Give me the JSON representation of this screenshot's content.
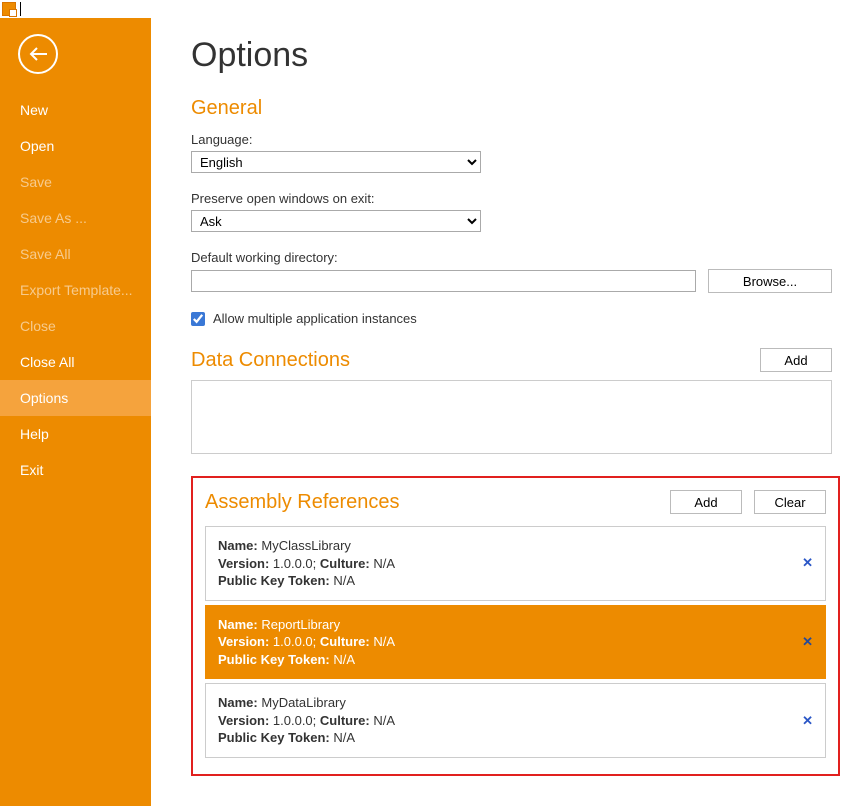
{
  "sidebar": {
    "items": [
      {
        "label": "New",
        "enabled": true,
        "selected": false
      },
      {
        "label": "Open",
        "enabled": true,
        "selected": false
      },
      {
        "label": "Save",
        "enabled": false,
        "selected": false
      },
      {
        "label": "Save As ...",
        "enabled": false,
        "selected": false
      },
      {
        "label": "Save All",
        "enabled": false,
        "selected": false
      },
      {
        "label": "Export Template...",
        "enabled": false,
        "selected": false
      },
      {
        "label": "Close",
        "enabled": false,
        "selected": false
      },
      {
        "label": "Close All",
        "enabled": true,
        "selected": false
      },
      {
        "label": "Options",
        "enabled": true,
        "selected": true
      },
      {
        "label": "Help",
        "enabled": true,
        "selected": false
      },
      {
        "label": "Exit",
        "enabled": true,
        "selected": false
      }
    ]
  },
  "page": {
    "title": "Options"
  },
  "general": {
    "heading": "General",
    "language_label": "Language:",
    "language_value": "English",
    "preserve_label": "Preserve open windows on exit:",
    "preserve_value": "Ask",
    "directory_label": "Default working directory:",
    "directory_value": "",
    "browse": "Browse...",
    "allow_multiple": "Allow multiple application instances",
    "allow_multiple_checked": true
  },
  "data_connections": {
    "heading": "Data Connections",
    "add": "Add"
  },
  "assembly_refs": {
    "heading": "Assembly References",
    "add": "Add",
    "clear": "Clear",
    "labels": {
      "name": "Name:",
      "version": "Version:",
      "culture": "Culture:",
      "pkt": "Public Key Token:"
    },
    "items": [
      {
        "name": "MyClassLibrary",
        "version": "1.0.0.0;",
        "culture": "N/A",
        "pkt": "N/A",
        "selected": false
      },
      {
        "name": "ReportLibrary",
        "version": "1.0.0.0;",
        "culture": "N/A",
        "pkt": "N/A",
        "selected": true
      },
      {
        "name": "MyDataLibrary",
        "version": "1.0.0.0;",
        "culture": "N/A",
        "pkt": "N/A",
        "selected": false
      }
    ],
    "remove_glyph": "✕"
  }
}
